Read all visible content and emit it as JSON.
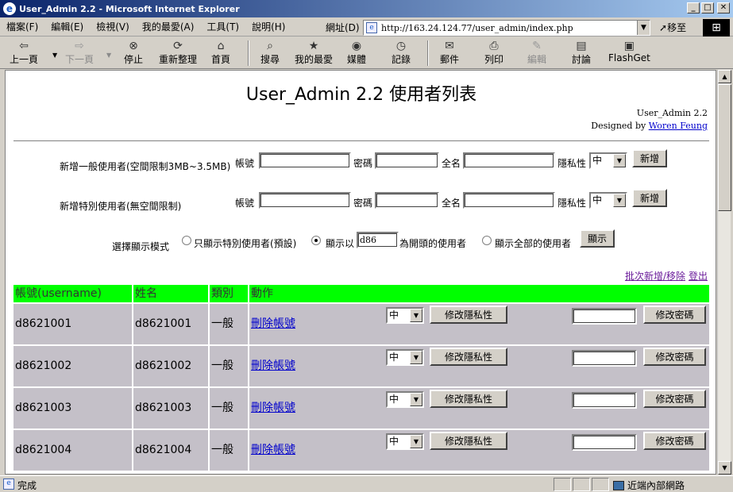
{
  "window": {
    "title": "User_Admin 2.2 - Microsoft Internet Explorer"
  },
  "menubar": {
    "items": [
      "檔案(F)",
      "編輯(E)",
      "檢視(V)",
      "我的最愛(A)",
      "工具(T)",
      "說明(H)"
    ],
    "address_label": "網址(D)",
    "url": "http://163.24.124.77/user_admin/index.php",
    "go_label": "移至"
  },
  "toolbar": {
    "buttons": [
      {
        "label": "上一頁",
        "icon": "back-arrow-icon",
        "enabled": true
      },
      {
        "label": "下一頁",
        "icon": "forward-arrow-icon",
        "enabled": false
      },
      {
        "label": "停止",
        "icon": "stop-icon",
        "enabled": true
      },
      {
        "label": "重新整理",
        "icon": "refresh-icon",
        "enabled": true
      },
      {
        "label": "首頁",
        "icon": "home-icon",
        "enabled": true
      },
      {
        "label": "搜尋",
        "icon": "search-icon",
        "enabled": true
      },
      {
        "label": "我的最愛",
        "icon": "favorites-icon",
        "enabled": true
      },
      {
        "label": "媒體",
        "icon": "media-icon",
        "enabled": true
      },
      {
        "label": "記錄",
        "icon": "history-icon",
        "enabled": true
      },
      {
        "label": "郵件",
        "icon": "mail-icon",
        "enabled": true
      },
      {
        "label": "列印",
        "icon": "print-icon",
        "enabled": true
      },
      {
        "label": "編輯",
        "icon": "edit-icon",
        "enabled": false
      },
      {
        "label": "討論",
        "icon": "discuss-icon",
        "enabled": true
      },
      {
        "label": "FlashGet",
        "icon": "flashget-icon",
        "enabled": true
      }
    ]
  },
  "page": {
    "title": "User_Admin 2.2 使用者列表",
    "credit_line1": "User_Admin 2.2",
    "credit_prefix": "Designed by ",
    "credit_author": "Woren Feung",
    "form_normal": {
      "label": "新增一般使用者(空間限制3MB~3.5MB)",
      "account_label": "帳號",
      "password_label": "密碼",
      "fullname_label": "全名",
      "privacy_label": "隱私性",
      "privacy_value": "中",
      "submit": "新增"
    },
    "form_special": {
      "label": "新增特別使用者(無空間限制)",
      "account_label": "帳號",
      "password_label": "密碼",
      "fullname_label": "全名",
      "privacy_label": "隱私性",
      "privacy_value": "中",
      "submit": "新增"
    },
    "display_mode": {
      "label": "選擇顯示模式",
      "option1": "只顯示特別使用者(預設)",
      "option2_prefix": "顯示以",
      "option2_value": "d86",
      "option2_suffix": "為開頭的使用者",
      "option3": "顯示全部的使用者",
      "submit": "顯示"
    },
    "links": {
      "batch": "批次新增/移除",
      "logout": "登出"
    },
    "table": {
      "headers": [
        "帳號(username)",
        "姓名",
        "類別",
        "動作"
      ],
      "rows": [
        {
          "username": "d8621001",
          "name": "d8621001",
          "type": "一般",
          "delete": "刪除帳號",
          "privacy": "中",
          "privacy_btn": "修改隱私性",
          "pw_btn": "修改密碼"
        },
        {
          "username": "d8621002",
          "name": "d8621002",
          "type": "一般",
          "delete": "刪除帳號",
          "privacy": "中",
          "privacy_btn": "修改隱私性",
          "pw_btn": "修改密碼"
        },
        {
          "username": "d8621003",
          "name": "d8621003",
          "type": "一般",
          "delete": "刪除帳號",
          "privacy": "中",
          "privacy_btn": "修改隱私性",
          "pw_btn": "修改密碼"
        },
        {
          "username": "d8621004",
          "name": "d8621004",
          "type": "一般",
          "delete": "刪除帳號",
          "privacy": "中",
          "privacy_btn": "修改隱私性",
          "pw_btn": "修改密碼"
        }
      ]
    }
  },
  "statusbar": {
    "text": "完成",
    "zone": "近端內部網路"
  },
  "colors": {
    "header_bg": "#00ff00",
    "row_bg": "#c4c0c8",
    "link": "#0000cc",
    "visited": "#6a1b9a"
  }
}
